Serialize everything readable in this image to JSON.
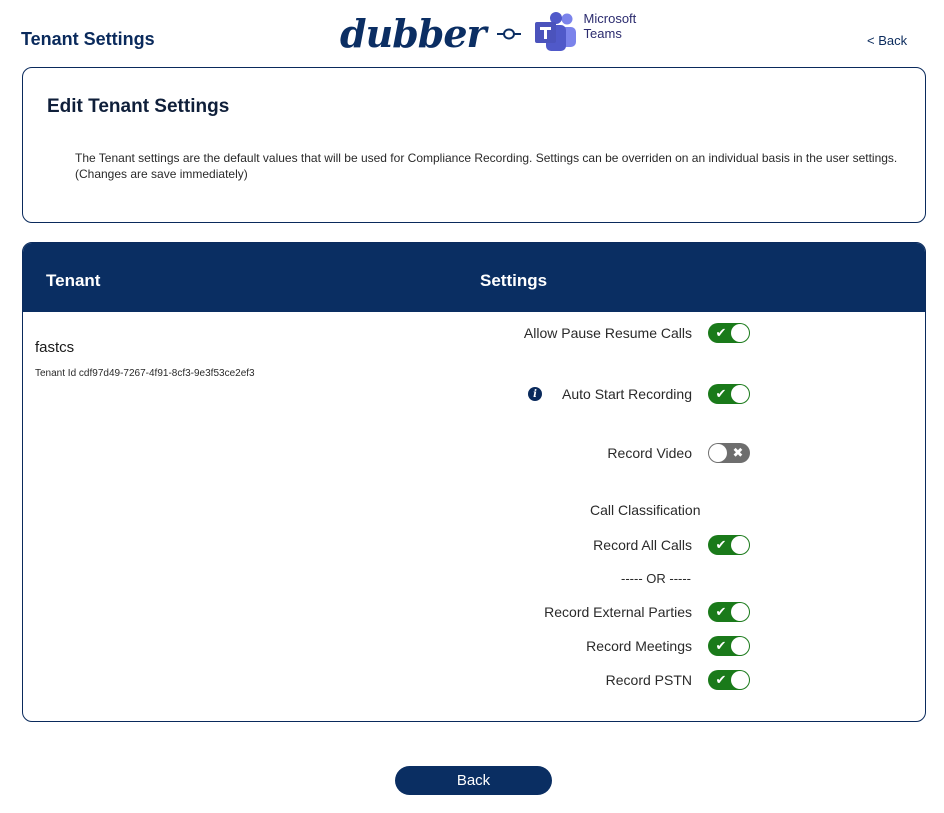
{
  "header": {
    "title": "Tenant Settings",
    "back_label": "< Back",
    "brand_name": "dubber",
    "partner_name": "Microsoft Teams",
    "colors": {
      "navy": "#0a2e62",
      "toggle_on": "#1a7a1a",
      "toggle_off": "#6e6e6e"
    }
  },
  "edit_card": {
    "title": "Edit Tenant Settings",
    "description_line1": "The Tenant settings are the default values that will be used for Compliance Recording. Settings can be overriden on an individual basis in the user settings.",
    "description_line2": "(Changes are save immediately)"
  },
  "table": {
    "headers": {
      "tenant": "Tenant",
      "settings": "Settings"
    },
    "tenant": {
      "name": "fastcs",
      "id_text": "Tenant Id cdf97d49-7267-4f91-8cf3-9e3f53ce2ef3"
    },
    "settings": {
      "allow_pause_resume": {
        "label": "Allow Pause Resume Calls",
        "enabled": true
      },
      "auto_start": {
        "label": "Auto Start Recording",
        "enabled": true,
        "info_icon": "info-icon"
      },
      "record_video": {
        "label": "Record Video",
        "enabled": false
      },
      "call_classification_label": "Call Classification",
      "record_all_calls": {
        "label": "Record All Calls",
        "enabled": true
      },
      "or_separator": "----- OR -----",
      "record_external": {
        "label": "Record External Parties",
        "enabled": true
      },
      "record_meetings": {
        "label": "Record Meetings",
        "enabled": true
      },
      "record_pstn": {
        "label": "Record PSTN",
        "enabled": true
      }
    }
  },
  "footer": {
    "back_button_label": "Back"
  }
}
